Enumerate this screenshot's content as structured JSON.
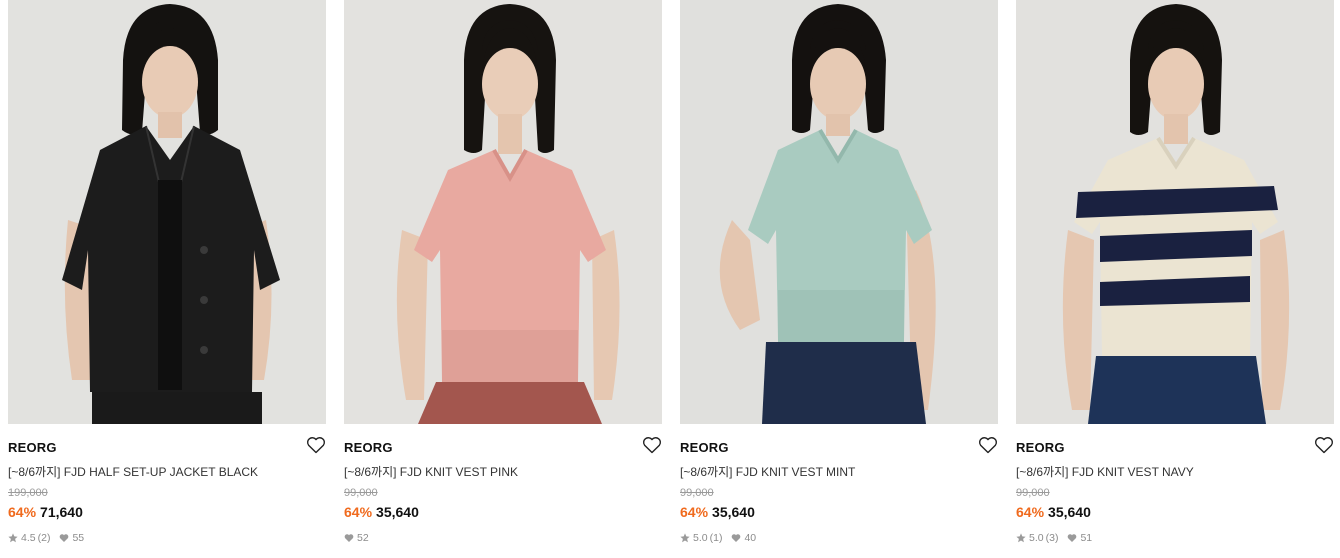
{
  "colors": {
    "discount": "#f06a1d",
    "text_primary": "#111111",
    "text_muted": "#9a9a9a",
    "photo_background": "#e2e2df"
  },
  "products": [
    {
      "brand": "REORG",
      "name": "[~8/6까지] FJD HALF SET-UP JACKET BLACK",
      "original_price": "199,000",
      "discount": "64%",
      "sale_price": "71,640",
      "rating": "4.5",
      "review_count": "(2)",
      "likes": "55",
      "garment": "black short-sleeve jacket",
      "garment_color": "#1c1c1c",
      "bottom_color": "#1a1a1a",
      "wishlist_icon": "heart-outline-icon"
    },
    {
      "brand": "REORG",
      "name": "[~8/6까지] FJD KNIT VEST PINK",
      "original_price": "99,000",
      "discount": "64%",
      "sale_price": "35,640",
      "rating": "",
      "review_count": "",
      "likes": "52",
      "garment": "pink knit vest",
      "garment_color": "#e8a9a0",
      "bottom_color": "#a3564e",
      "wishlist_icon": "heart-outline-icon"
    },
    {
      "brand": "REORG",
      "name": "[~8/6까지] FJD KNIT VEST MINT",
      "original_price": "99,000",
      "discount": "64%",
      "sale_price": "35,640",
      "rating": "5.0",
      "review_count": "(1)",
      "likes": "40",
      "garment": "mint knit vest",
      "garment_color": "#a9cbc0",
      "bottom_color": "#1f2d4a",
      "wishlist_icon": "heart-outline-icon"
    },
    {
      "brand": "REORG",
      "name": "[~8/6까지] FJD KNIT VEST NAVY",
      "original_price": "99,000",
      "discount": "64%",
      "sale_price": "35,640",
      "rating": "5.0",
      "review_count": "(3)",
      "likes": "51",
      "garment": "navy striped knit vest",
      "garment_color": "#ebe4d2",
      "stripe_color": "#1a2140",
      "bottom_color": "#1e3358",
      "wishlist_icon": "heart-outline-icon"
    }
  ]
}
